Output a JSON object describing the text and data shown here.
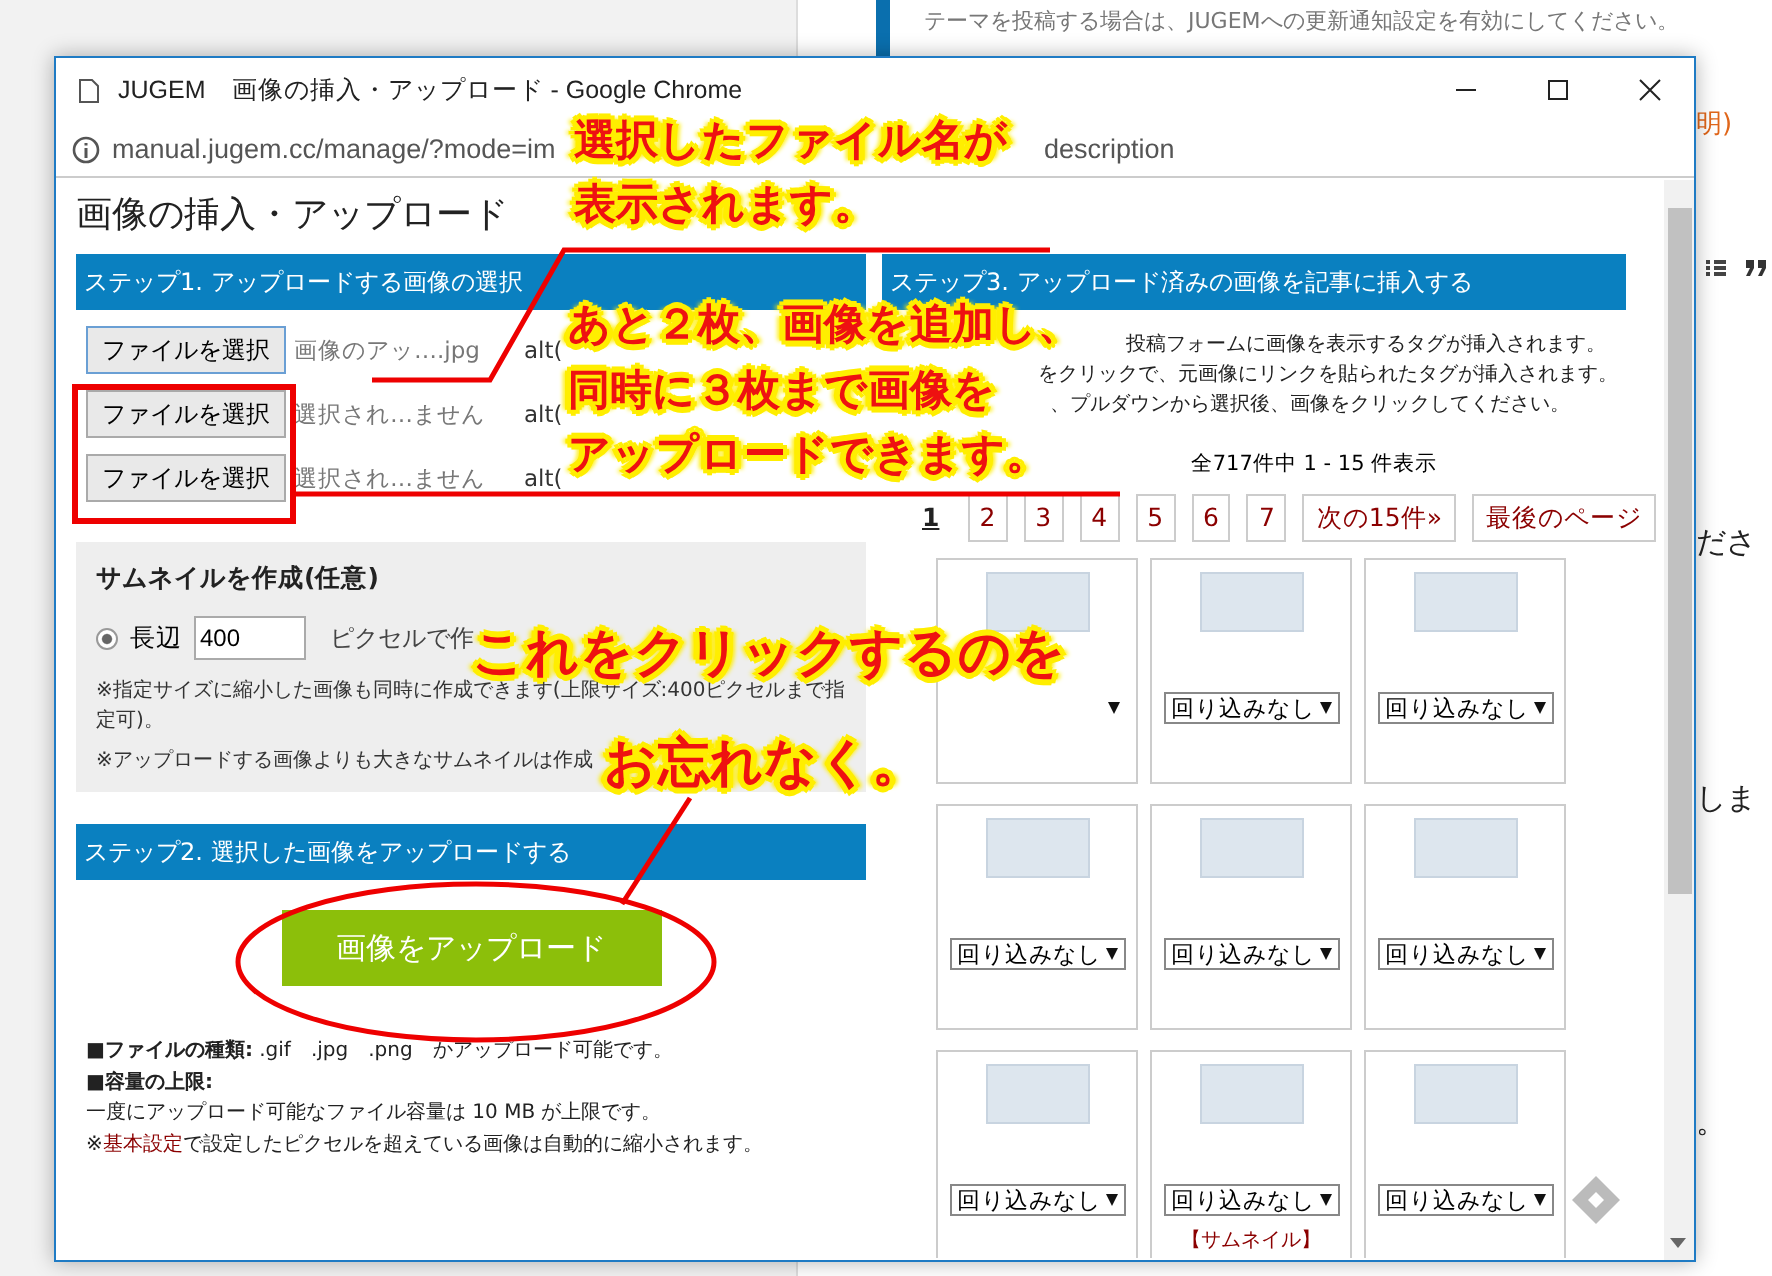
{
  "background_page": {
    "notice": "テーマを投稿する場合は、JUGEMへの更新通知設定を有効にしてください。",
    "fragments": [
      {
        "kind": "link",
        "text": "明)"
      },
      {
        "kind": "text",
        "text": "ださ"
      },
      {
        "kind": "text",
        "text": "しま"
      },
      {
        "kind": "text",
        "text": "。"
      }
    ]
  },
  "window": {
    "title": "JUGEM　画像の挿入・アップロード - Google Chrome",
    "url": "manual.jugem.cc/manage/?mode=im",
    "url_tail": "description"
  },
  "page_title": "画像の挿入・アップロード",
  "step1": {
    "header": "ステップ1. アップロードする画像の選択",
    "rows": [
      {
        "button": "ファイルを選択",
        "file": "画像のアッ….jpg",
        "alt_label": "alt("
      },
      {
        "button": "ファイルを選択",
        "file": "選択され…ません",
        "alt_label": "alt("
      },
      {
        "button": "ファイルを選択",
        "file": "選択され…ません",
        "alt_label": "alt("
      }
    ]
  },
  "thumbnail": {
    "title": "サムネイルを作成(任意)",
    "option": {
      "selected": true,
      "label": "長辺",
      "value": "400",
      "suffix": "ピクセルで作"
    },
    "notes": [
      "※指定サイズに縮小した画像も同時に作成できます(上限サイズ:400ピクセルまで指定可)。",
      "※アップロードする画像よりも大きなサムネイルは作成"
    ]
  },
  "step2": {
    "header": "ステップ2. 選択した画像をアップロードする",
    "button": "画像をアップロード",
    "info": [
      {
        "kind": "text",
        "text": "**■ファイルの種類:** .gif　.jpg　.png　かアップロード可能です。"
      },
      {
        "kind": "heading",
        "text": "■容量の上限:"
      },
      {
        "kind": "text",
        "text": "一度にアップロード可能なファイル容量は 10 MB が上限です。"
      },
      {
        "kind": "link_note",
        "prefix": "※",
        "link": "基本設定",
        "suffix": "で設定したピクセルを超えている画像は自動的に縮小されます。"
      }
    ]
  },
  "step3": {
    "header": "ステップ3. アップロード済みの画像を記事に挿入する",
    "description": [
      "投稿フォームに画像を表示するタグが挿入されます。",
      "をクリックで、元画像にリンクを貼られたタグが挿入されます。",
      "、プルダウンから選択後、画像をクリックしてください。"
    ],
    "count": "全717件中 1 - 15 件表示",
    "pages": [
      {
        "label": "1",
        "selected": true
      },
      {
        "label": "2",
        "selected": false
      },
      {
        "label": "3",
        "selected": false
      },
      {
        "label": "4",
        "selected": false
      },
      {
        "label": "5",
        "selected": false
      },
      {
        "label": "6",
        "selected": false
      },
      {
        "label": "7",
        "selected": false
      }
    ],
    "next": "次の15件»",
    "last": "最後のページ",
    "images": [
      {
        "kind": "covered"
      },
      {
        "kind": "select",
        "select": "回り込みなし"
      },
      {
        "kind": "select",
        "select": "回り込みなし"
      },
      {
        "kind": "select",
        "select": "回り込みなし"
      },
      {
        "kind": "select",
        "select": "回り込みなし"
      },
      {
        "kind": "select",
        "select": "回り込みなし"
      },
      {
        "kind": "select",
        "select": "回り込みなし"
      },
      {
        "kind": "select",
        "select": "回り込みなし",
        "caption": "【サムネイル】"
      },
      {
        "kind": "select",
        "select": "回り込みなし"
      }
    ]
  },
  "callouts": [
    {
      "lines": [
        "選択したファイル名が",
        "表示されます。"
      ]
    },
    {
      "lines": [
        "あと２枚、画像を追加し、",
        "同時に３枚まで画像を",
        "アップロードできます。"
      ]
    },
    {
      "lines": [
        "これをクリックするのを",
        "お忘れなく。"
      ]
    }
  ]
}
